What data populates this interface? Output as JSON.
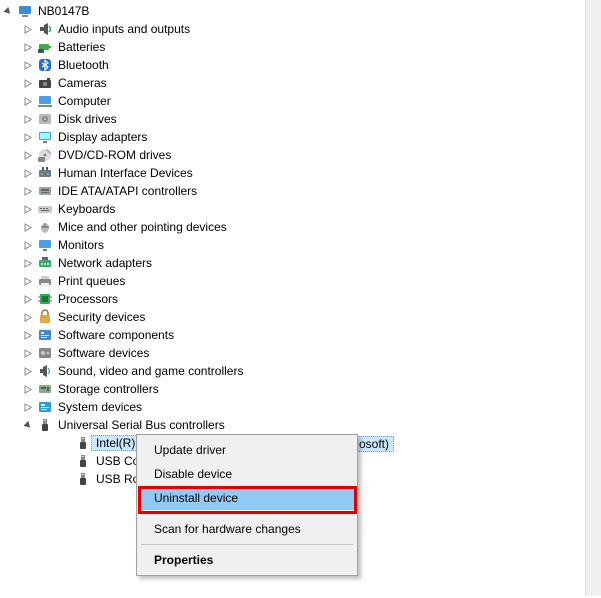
{
  "root": {
    "label": "NB0147B"
  },
  "categories": [
    {
      "label": "Audio inputs and outputs",
      "icon": "audio"
    },
    {
      "label": "Batteries",
      "icon": "battery"
    },
    {
      "label": "Bluetooth",
      "icon": "bluetooth"
    },
    {
      "label": "Cameras",
      "icon": "camera"
    },
    {
      "label": "Computer",
      "icon": "computer"
    },
    {
      "label": "Disk drives",
      "icon": "disk"
    },
    {
      "label": "Display adapters",
      "icon": "display"
    },
    {
      "label": "DVD/CD-ROM drives",
      "icon": "dvd"
    },
    {
      "label": "Human Interface Devices",
      "icon": "hid"
    },
    {
      "label": "IDE ATA/ATAPI controllers",
      "icon": "ide"
    },
    {
      "label": "Keyboards",
      "icon": "keyboard"
    },
    {
      "label": "Mice and other pointing devices",
      "icon": "mouse"
    },
    {
      "label": "Monitors",
      "icon": "monitor"
    },
    {
      "label": "Network adapters",
      "icon": "network"
    },
    {
      "label": "Print queues",
      "icon": "printer"
    },
    {
      "label": "Processors",
      "icon": "cpu"
    },
    {
      "label": "Security devices",
      "icon": "security"
    },
    {
      "label": "Software components",
      "icon": "swcomp"
    },
    {
      "label": "Software devices",
      "icon": "swdev"
    },
    {
      "label": "Sound, video and game controllers",
      "icon": "sound"
    },
    {
      "label": "Storage controllers",
      "icon": "storage"
    },
    {
      "label": "System devices",
      "icon": "system"
    },
    {
      "label": "Universal Serial Bus controllers",
      "icon": "usb"
    }
  ],
  "usb_children": [
    {
      "label": "Intel(R) U",
      "icon": "usb",
      "selected": true
    },
    {
      "label": "USB Com",
      "icon": "usb"
    },
    {
      "label": "USB Root",
      "icon": "usb"
    }
  ],
  "selected_suffix": "osoft)",
  "context_menu": {
    "items": [
      {
        "label": "Update driver"
      },
      {
        "label": "Disable device"
      },
      {
        "label": "Uninstall device",
        "highlight": true
      },
      {
        "sep": true
      },
      {
        "label": "Scan for hardware changes"
      },
      {
        "sep": true
      },
      {
        "label": "Properties",
        "bold": true
      }
    ]
  }
}
